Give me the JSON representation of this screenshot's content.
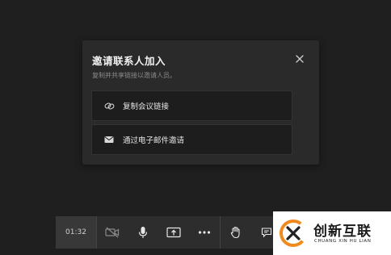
{
  "dialog": {
    "title": "邀请联系人加入",
    "subtitle": "复制并共享链接以邀请人员。",
    "close_icon": "close-icon",
    "options": [
      {
        "label": "复制会议链接",
        "icon": "link-icon"
      },
      {
        "label": "通过电子邮件邀请",
        "icon": "mail-icon"
      }
    ]
  },
  "toolbar": {
    "timer": "01:32",
    "buttons": [
      "camera-off-icon",
      "microphone-icon",
      "share-screen-icon",
      "more-icon",
      "raise-hand-icon",
      "chat-icon"
    ]
  },
  "watermark": {
    "name": "创新互联",
    "pinyin": "CHUANG XIN HU LIAN"
  },
  "colors": {
    "background": "#1f1f1f",
    "dialog": "#2a2a2a",
    "option": "#1d1d1d",
    "toolbar": "#2d2d2d",
    "logo_orange": "#f08a1c"
  }
}
